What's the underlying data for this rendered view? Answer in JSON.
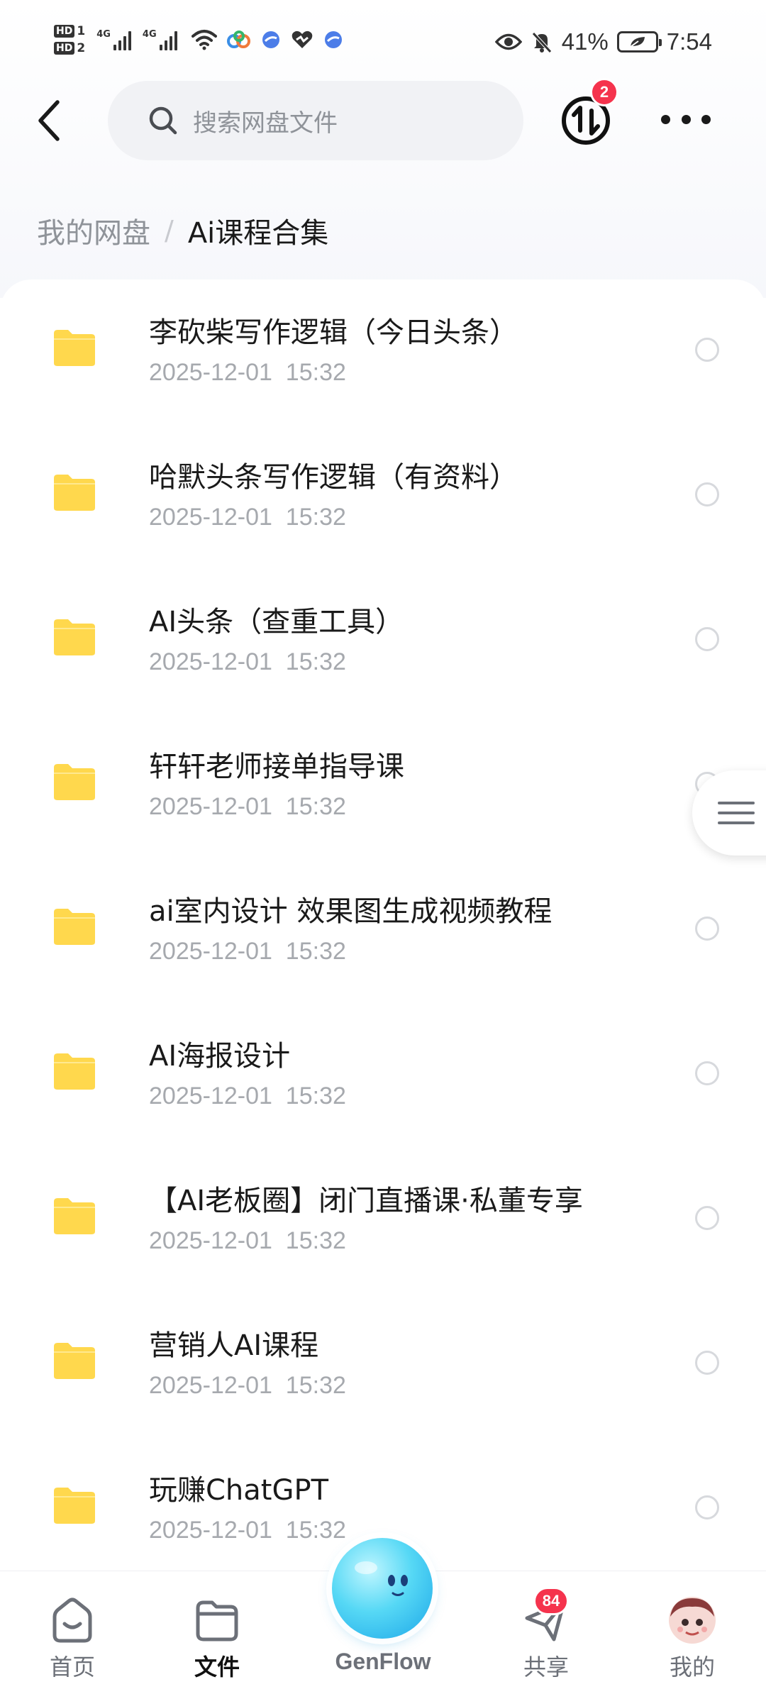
{
  "status_bar": {
    "hd1": "HD",
    "hd1_sub": "1",
    "hd2": "HD",
    "hd2_sub": "2",
    "net1": "4G",
    "net2": "4G",
    "battery": "41%",
    "time": "7:54"
  },
  "header": {
    "search_placeholder": "搜索网盘文件",
    "transfer_badge": "2"
  },
  "breadcrumb": {
    "root": "我的网盘",
    "separator": "/",
    "current": "Ai课程合集"
  },
  "files": [
    {
      "name": "李砍柴写作逻辑（今日头条）",
      "date": "2025-12-01  15:32"
    },
    {
      "name": "哈默头条写作逻辑（有资料）",
      "date": "2025-12-01  15:32"
    },
    {
      "name": "AI头条（查重工具）",
      "date": "2025-12-01  15:32"
    },
    {
      "name": "轩轩老师接单指导课",
      "date": "2025-12-01  15:32"
    },
    {
      "name": "ai室内设计 效果图生成视频教程",
      "date": "2025-12-01  15:32"
    },
    {
      "name": "AI海报设计",
      "date": "2025-12-01  15:32"
    },
    {
      "name": "【AI老板圈】闭门直播课·私董专享",
      "date": "2025-12-01  15:32"
    },
    {
      "name": "营销人AI课程",
      "date": "2025-12-01  15:32"
    },
    {
      "name": "玩赚ChatGPT",
      "date": "2025-12-01  15:32"
    }
  ],
  "bottom_nav": {
    "home": "首页",
    "files": "文件",
    "genflow": "GenFlow",
    "share": "共享",
    "share_badge": "84",
    "mine": "我的"
  },
  "colors": {
    "folder": "#ffd84d",
    "badge": "#f5334d",
    "accent_orb": "#38c7f0"
  }
}
